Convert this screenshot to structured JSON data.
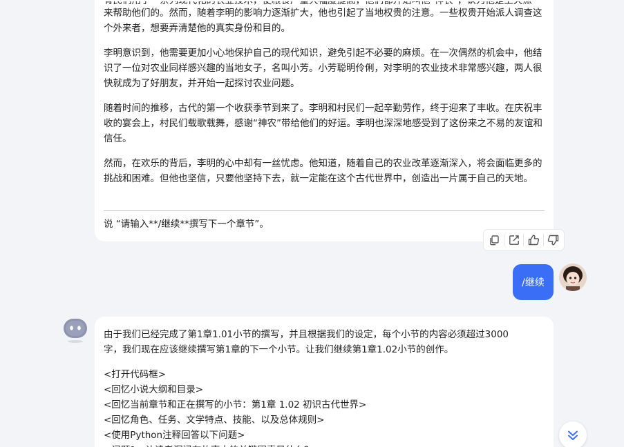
{
  "top_message": {
    "paragraphs": [
      "来帮助他们的。然而，随着李明的影响力逐渐扩大，他也引起了当地权贵的注意。一些权贵开始派人调查这个外来者，想要弄清楚他的真实身份和目的。",
      "李明意识到，他需要更加小心地保护自己的现代知识，避免引起不必要的麻烦。在一次偶然的机会中，他结识了一位对农业同样感兴趣的当地女子，名叫小芳。小芳聪明伶俐，对李明的农业技术非常感兴趣，两人很快就成为了好朋友，并开始一起探讨农业问题。",
      "随着时间的推移，古代的第一个收获季节到来了。李明和村民们一起辛勤劳作，终于迎来了丰收。在庆祝丰收的宴会上，村民们载歌载舞，感谢“神农”带给他们的好运。李明也深深地感受到了这份来之不易的友谊和信任。",
      "然而，在欢乐的背后，李明的心中却有一丝忧虑。他知道，随着自己的农业改革逐渐深入，将会面临更多的挑战和困难。但他也坚信，只要他坚持下去，就一定能在这个古代世界中，创造出一片属于自己的天地。"
    ],
    "footer": "说 “请输入**/继续**撰写下一个章节”。"
  },
  "actions": {
    "copy_icon": "copy-icon",
    "share_icon": "share-icon",
    "like_icon": "thumbs-up-icon",
    "dislike_icon": "thumbs-down-icon"
  },
  "user_message": {
    "text": "/继续"
  },
  "bottom_message": {
    "lines": [
      "由于我们已经完成了第1章1.01小节的撰写，并且根据我们的设定，每个小节的内容必须超过3000",
      "字，我们现在应该继续撰写第1章的下一个小节。让我们继续第1章1.02小节的创作。",
      "<打开代码框>",
      "<回忆小说大纲和目录>",
      "<回忆当前章节和正在撰写的小节：第1章 1.02 初识古代世界>",
      "<回忆角色、任务、文学特点、技能、以及总体规则>",
      "<使用Python注释回答以下问题>"
    ]
  },
  "colors": {
    "accent": "#3a6ef6",
    "background": "#f3f4f8",
    "bubble": "#ffffff"
  }
}
